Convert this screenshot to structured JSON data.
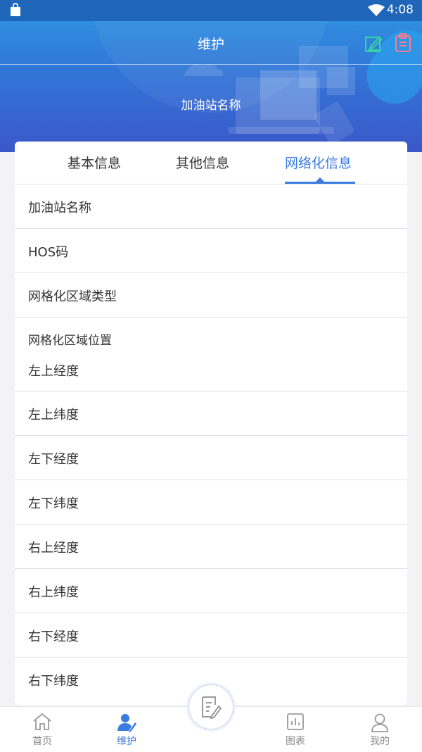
{
  "status_bar": {
    "time": "4:08"
  },
  "header": {
    "title": "维护",
    "station_name": "加油站名称"
  },
  "tabs": [
    {
      "label": "基本信息"
    },
    {
      "label": "其他信息"
    },
    {
      "label": "网络化信息",
      "active": true
    }
  ],
  "fields": {
    "station_name": "加油站名称",
    "hos_code": "HOS码",
    "grid_area_type": "网格化区域类型",
    "grid_area_position": "网格化区域位置",
    "top_left_lng": "左上经度",
    "top_left_lat": "左上纬度",
    "bottom_left_lng": "左下经度",
    "bottom_left_lat": "左下纬度",
    "top_right_lng": "右上经度",
    "top_right_lat": "右上纬度",
    "bottom_right_lng": "右下经度",
    "bottom_right_lat": "右下纬度"
  },
  "bottom_nav": {
    "home": "首页",
    "maintenance": "维护",
    "charts": "图表",
    "mine": "我的"
  },
  "colors": {
    "accent": "#3a7be0",
    "header_top": "#2f8ddf",
    "header_bottom": "#3b58c8",
    "status_bar": "#1f65b8"
  }
}
